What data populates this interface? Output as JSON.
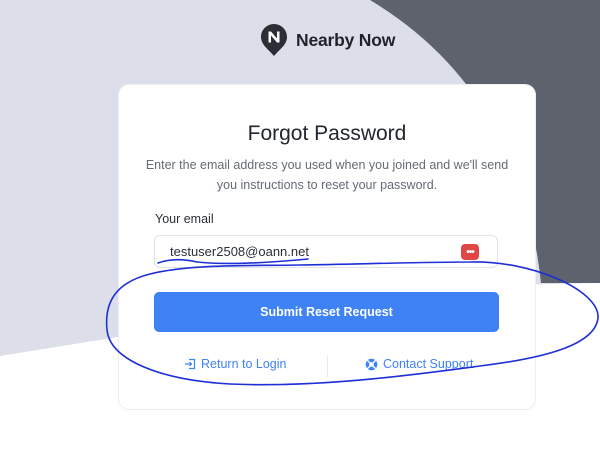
{
  "brand": {
    "name": "Nearby Now",
    "logo_icon": "nearby-now-logo-icon"
  },
  "colors": {
    "accent": "#3f82f5",
    "background_light": "#dcdfe9",
    "background_dark": "#5e626d",
    "password_manager_icon": "#e04646",
    "annotation_ink": "#1f2fd6"
  },
  "card": {
    "title": "Forgot Password",
    "subtitle": "Enter the email address you used when you joined and we'll send you instructions to reset your password."
  },
  "form": {
    "email_label": "Your email",
    "email_value": "testuser2508@oann.net",
    "password_manager_icon": "password-dots-icon",
    "submit_label": "Submit Reset Request"
  },
  "links": {
    "return_label": "Return to Login",
    "return_icon": "sign-in-icon",
    "support_label": "Contact Support",
    "support_icon": "lifebuoy-icon"
  }
}
